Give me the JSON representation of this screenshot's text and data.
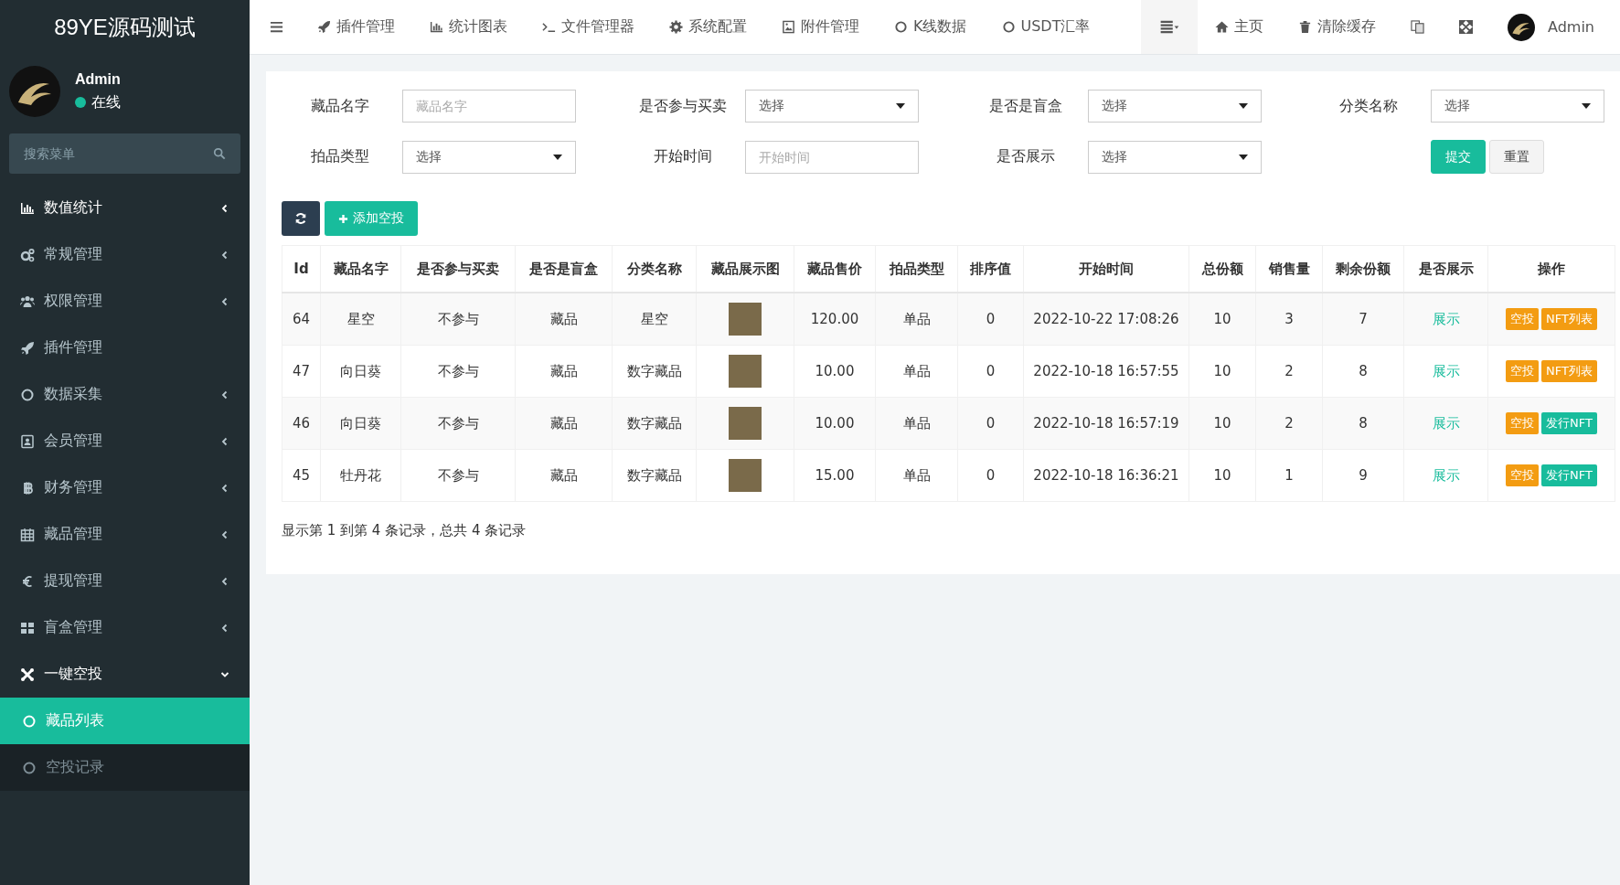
{
  "sidebar": {
    "brand": "89YE源码测试",
    "user": {
      "name": "Admin",
      "status": "在线",
      "online": true
    },
    "search": {
      "placeholder": "搜索菜单"
    },
    "items": [
      {
        "label": "数值统计",
        "kind": "group",
        "expanded": false
      },
      {
        "label": "常规管理",
        "kind": "group",
        "expanded": false
      },
      {
        "label": "权限管理",
        "kind": "group",
        "expanded": false
      },
      {
        "label": "插件管理",
        "kind": "link"
      },
      {
        "label": "数据采集",
        "kind": "group",
        "expanded": false
      },
      {
        "label": "会员管理",
        "kind": "group",
        "expanded": false
      },
      {
        "label": "财务管理",
        "kind": "group",
        "expanded": false
      },
      {
        "label": "藏品管理",
        "kind": "group",
        "expanded": false
      },
      {
        "label": "提现管理",
        "kind": "group",
        "expanded": false
      },
      {
        "label": "盲盒管理",
        "kind": "group",
        "expanded": false
      },
      {
        "label": "一键空投",
        "kind": "group",
        "expanded": true,
        "children": [
          {
            "label": "藏品列表",
            "selected": true
          },
          {
            "label": "空投记录",
            "selected": false
          }
        ]
      }
    ]
  },
  "topbar": {
    "nav": [
      "插件管理",
      "统计图表",
      "文件管理器",
      "系统配置",
      "附件管理",
      "K线数据",
      "USDT汇率"
    ],
    "right": [
      "主页",
      "清除缓存"
    ],
    "user": "Admin"
  },
  "filters": [
    {
      "label": "藏品名字",
      "kind": "text",
      "placeholder": "藏品名字"
    },
    {
      "label": "是否参与买卖",
      "kind": "select",
      "value": "选择"
    },
    {
      "label": "是否是盲盒",
      "kind": "select",
      "value": "选择"
    },
    {
      "label": "分类名称",
      "kind": "select",
      "value": "选择"
    },
    {
      "label": "拍品类型",
      "kind": "select",
      "value": "选择"
    },
    {
      "label": "开始时间",
      "kind": "text",
      "placeholder": "开始时间"
    },
    {
      "label": "是否展示",
      "kind": "select",
      "value": "选择"
    }
  ],
  "filter_buttons": [
    {
      "label": "提交",
      "kind": "primary"
    },
    {
      "label": "重置",
      "kind": "default"
    }
  ],
  "toolbar": {
    "add_label": "添加空投"
  },
  "table": {
    "columns": [
      "Id",
      "藏品名字",
      "是否参与买卖",
      "是否是盲盒",
      "分类名称",
      "藏品展示图",
      "藏品售价",
      "拍品类型",
      "排序值",
      "开始时间",
      "总份额",
      "销售量",
      "剩余份额",
      "是否展示",
      "操作"
    ],
    "rows": [
      {
        "cells": [
          "64",
          "星空",
          "不参与",
          "藏品",
          "星空",
          "",
          "120.00",
          "单品",
          "0",
          "2022-10-22 17:08:26",
          "10",
          "3",
          "7",
          "展示"
        ],
        "actions": [
          {
            "label": "空投",
            "kind": "warning"
          },
          {
            "label": "NFT列表",
            "kind": "warning"
          }
        ]
      },
      {
        "cells": [
          "47",
          "向日葵",
          "不参与",
          "藏品",
          "数字藏品",
          "",
          "10.00",
          "单品",
          "0",
          "2022-10-18 16:57:55",
          "10",
          "2",
          "8",
          "展示"
        ],
        "actions": [
          {
            "label": "空投",
            "kind": "warning"
          },
          {
            "label": "NFT列表",
            "kind": "warning"
          }
        ]
      },
      {
        "cells": [
          "46",
          "向日葵",
          "不参与",
          "藏品",
          "数字藏品",
          "",
          "10.00",
          "单品",
          "0",
          "2022-10-18 16:57:19",
          "10",
          "2",
          "8",
          "展示"
        ],
        "actions": [
          {
            "label": "空投",
            "kind": "warning"
          },
          {
            "label": "发行NFT",
            "kind": "success"
          }
        ]
      },
      {
        "cells": [
          "45",
          "牡丹花",
          "不参与",
          "藏品",
          "数字藏品",
          "",
          "15.00",
          "单品",
          "0",
          "2022-10-18 16:36:21",
          "10",
          "1",
          "9",
          "展示"
        ],
        "actions": [
          {
            "label": "空投",
            "kind": "warning"
          },
          {
            "label": "发行NFT",
            "kind": "success"
          }
        ]
      }
    ]
  },
  "pagination_info": "显示第 1 到第 4 条记录，总共 4 条记录"
}
